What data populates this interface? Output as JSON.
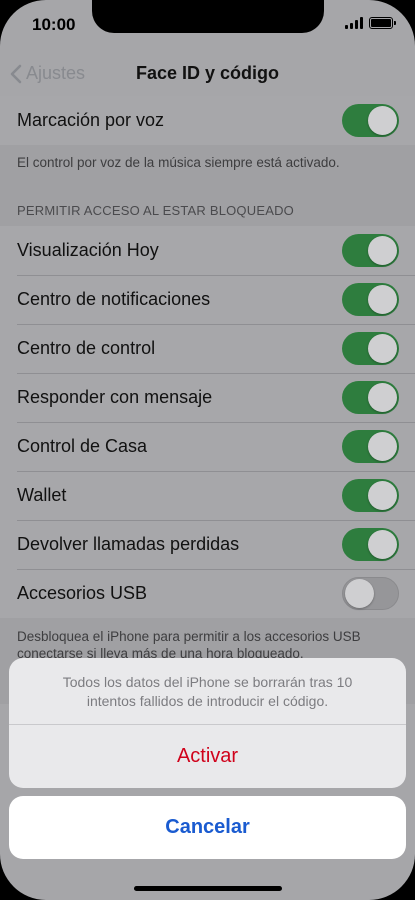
{
  "status_bar": {
    "time": "10:00"
  },
  "nav": {
    "back_label": "Ajustes",
    "title": "Face ID y código"
  },
  "voice_dial": {
    "label": "Marcación por voz",
    "on": true
  },
  "voice_note": "El control por voz de la música siempre está activado.",
  "locked_section": {
    "header": "PERMITIR ACCESO AL ESTAR BLOQUEADO",
    "items": [
      {
        "label": "Visualización Hoy",
        "on": true
      },
      {
        "label": "Centro de notificaciones",
        "on": true
      },
      {
        "label": "Centro de control",
        "on": true
      },
      {
        "label": "Responder con mensaje",
        "on": true
      },
      {
        "label": "Control de Casa",
        "on": true
      },
      {
        "label": "Wallet",
        "on": true
      },
      {
        "label": "Devolver llamadas perdidas",
        "on": true
      },
      {
        "label": "Accesorios USB",
        "on": false
      }
    ],
    "footer": "Desbloquea el iPhone para permitir a los accesorios USB conectarse si lleva más de una hora bloqueado."
  },
  "action_sheet": {
    "message": "Todos los datos del iPhone se borrarán tras 10 intentos fallidos de introducir el código.",
    "action_label": "Activar",
    "cancel_label": "Cancelar"
  },
  "colors": {
    "toggle_on": "#2e7d3e",
    "destructive": "#d0021b",
    "cancel": "#1a5bd0"
  }
}
